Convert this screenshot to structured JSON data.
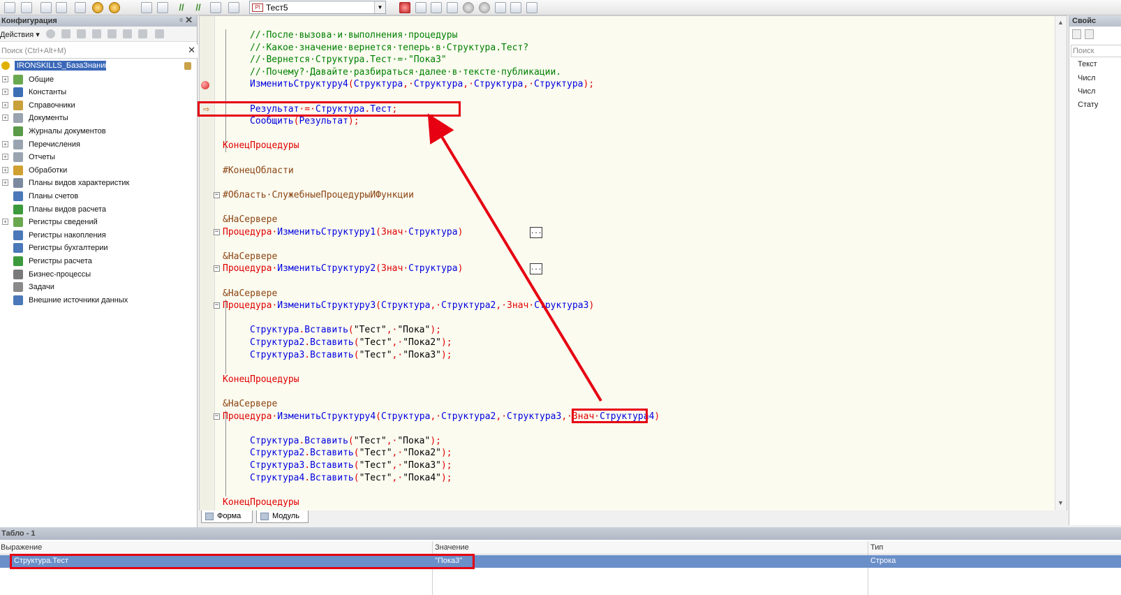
{
  "toolbar": {
    "combo_value": "Тест5",
    "combo_badge": "Pl"
  },
  "left_panel": {
    "title": "Конфигурация",
    "pin_glyph": "ᵠ",
    "close_glyph": "✕",
    "actions_label": "Действия ▾",
    "search_placeholder": "Поиск (Ctrl+Alt+M)",
    "search_clear": "✕",
    "root": "IRONSKILLS_БазаЗнаний",
    "items": [
      {
        "label": "Общие",
        "expandable": true,
        "icon_color": "#6aa84f"
      },
      {
        "label": "Константы",
        "expandable": true,
        "icon_color": "#3d6fb5"
      },
      {
        "label": "Справочники",
        "expandable": true,
        "icon_color": "#c9a13c"
      },
      {
        "label": "Документы",
        "expandable": true,
        "icon_color": "#9aa4b0"
      },
      {
        "label": "Журналы документов",
        "expandable": false,
        "icon_color": "#5a9a48"
      },
      {
        "label": "Перечисления",
        "expandable": true,
        "icon_color": "#9aa4b0"
      },
      {
        "label": "Отчеты",
        "expandable": true,
        "icon_color": "#9aa4b0"
      },
      {
        "label": "Обработки",
        "expandable": true,
        "icon_color": "#d0a030"
      },
      {
        "label": "Планы видов характеристик",
        "expandable": true,
        "icon_color": "#7c8aa0"
      },
      {
        "label": "Планы счетов",
        "expandable": false,
        "icon_color": "#4a78b8"
      },
      {
        "label": "Планы видов расчета",
        "expandable": false,
        "icon_color": "#3c9a3c"
      },
      {
        "label": "Регистры сведений",
        "expandable": true,
        "icon_color": "#6aa84f"
      },
      {
        "label": "Регистры накопления",
        "expandable": false,
        "icon_color": "#4a78b8"
      },
      {
        "label": "Регистры бухгалтерии",
        "expandable": false,
        "icon_color": "#4a78b8"
      },
      {
        "label": "Регистры расчета",
        "expandable": false,
        "icon_color": "#3c9a3c"
      },
      {
        "label": "Бизнес-процессы",
        "expandable": false,
        "icon_color": "#7a7a7a"
      },
      {
        "label": "Задачи",
        "expandable": false,
        "icon_color": "#8a8a8a"
      },
      {
        "label": "Внешние источники данных",
        "expandable": false,
        "icon_color": "#4a78b8"
      }
    ]
  },
  "editor": {
    "fold_minus": "⊟",
    "dots_label": "...",
    "lines": [
      [
        {
          "t": "//·После·вызова·и·выполнения·процедуры",
          "c": "cm"
        }
      ],
      [
        {
          "t": "//·Какое·значение·вернется·теперь·в·Структура.Тест?",
          "c": "cm"
        }
      ],
      [
        {
          "t": "//·Вернется·Структура.Тест·=·\"Пока3\"",
          "c": "cm"
        }
      ],
      [
        {
          "t": "//·Почему?·Давайте·разбираться·далее·в·тексте·публикации.",
          "c": "cm"
        }
      ],
      [
        {
          "t": "ИзменитьСтруктуру4",
          "c": "id"
        },
        {
          "t": "(",
          "c": "kw"
        },
        {
          "t": "Структура",
          "c": "id"
        },
        {
          "t": ",·",
          "c": "kw"
        },
        {
          "t": "Структура",
          "c": "id"
        },
        {
          "t": ",·",
          "c": "kw"
        },
        {
          "t": "Структура",
          "c": "id"
        },
        {
          "t": ",·",
          "c": "kw"
        },
        {
          "t": "Структура",
          "c": "id"
        },
        {
          "t": ");",
          "c": "kw"
        }
      ],
      [],
      [
        {
          "t": "Результат",
          "c": "id"
        },
        {
          "t": "·=·",
          "c": "kw"
        },
        {
          "t": "Структура",
          "c": "id"
        },
        {
          "t": ".",
          "c": "kw"
        },
        {
          "t": "Тест",
          "c": "id"
        },
        {
          "t": ";",
          "c": "kw"
        }
      ],
      [
        {
          "t": "Сообщить",
          "c": "id"
        },
        {
          "t": "(",
          "c": "kw"
        },
        {
          "t": "Результат",
          "c": "id"
        },
        {
          "t": ");",
          "c": "kw"
        }
      ],
      [],
      [
        {
          "t": "КонецПроцедуры",
          "c": "kw"
        }
      ],
      [],
      [
        {
          "t": "#КонецОбласти",
          "c": "pr"
        }
      ],
      [],
      [
        {
          "t": "#Область·СлужебныеПроцедурыИФункции",
          "c": "pr"
        }
      ],
      [],
      [
        {
          "t": "&НаСервере",
          "c": "pr"
        }
      ],
      [
        {
          "t": "Процедура",
          "c": "kw"
        },
        {
          "t": "·",
          "c": "kw"
        },
        {
          "t": "ИзменитьСтруктуру1",
          "c": "id"
        },
        {
          "t": "(",
          "c": "kw"
        },
        {
          "t": "Знач",
          "c": "kw"
        },
        {
          "t": "·",
          "c": "kw"
        },
        {
          "t": "Структура",
          "c": "id"
        },
        {
          "t": ")",
          "c": "kw"
        }
      ],
      [],
      [
        {
          "t": "&НаСервере",
          "c": "pr"
        }
      ],
      [
        {
          "t": "Процедура",
          "c": "kw"
        },
        {
          "t": "·",
          "c": "kw"
        },
        {
          "t": "ИзменитьСтруктуру2",
          "c": "id"
        },
        {
          "t": "(",
          "c": "kw"
        },
        {
          "t": "Знач",
          "c": "kw"
        },
        {
          "t": "·",
          "c": "kw"
        },
        {
          "t": "Структура",
          "c": "id"
        },
        {
          "t": ")",
          "c": "kw"
        }
      ],
      [],
      [
        {
          "t": "&НаСервере",
          "c": "pr"
        }
      ],
      [
        {
          "t": "Процедура",
          "c": "kw"
        },
        {
          "t": "·",
          "c": "kw"
        },
        {
          "t": "ИзменитьСтруктуру3",
          "c": "id"
        },
        {
          "t": "(",
          "c": "kw"
        },
        {
          "t": "Структура",
          "c": "id"
        },
        {
          "t": ",·",
          "c": "kw"
        },
        {
          "t": "Структура2",
          "c": "id"
        },
        {
          "t": ",·",
          "c": "kw"
        },
        {
          "t": "Знач",
          "c": "kw"
        },
        {
          "t": "·",
          "c": "kw"
        },
        {
          "t": "Структура3",
          "c": "id"
        },
        {
          "t": ")",
          "c": "kw"
        }
      ],
      [],
      [
        {
          "t": "Структура",
          "c": "id"
        },
        {
          "t": ".",
          "c": "kw"
        },
        {
          "t": "Вставить",
          "c": "id"
        },
        {
          "t": "(",
          "c": "kw"
        },
        {
          "t": "\"Тест\"",
          "c": "st"
        },
        {
          "t": ",·",
          "c": "kw"
        },
        {
          "t": "\"Пока\"",
          "c": "st"
        },
        {
          "t": ");",
          "c": "kw"
        }
      ],
      [
        {
          "t": "Структура2",
          "c": "id"
        },
        {
          "t": ".",
          "c": "kw"
        },
        {
          "t": "Вставить",
          "c": "id"
        },
        {
          "t": "(",
          "c": "kw"
        },
        {
          "t": "\"Тест\"",
          "c": "st"
        },
        {
          "t": ",·",
          "c": "kw"
        },
        {
          "t": "\"Пока2\"",
          "c": "st"
        },
        {
          "t": ");",
          "c": "kw"
        }
      ],
      [
        {
          "t": "Структура3",
          "c": "id"
        },
        {
          "t": ".",
          "c": "kw"
        },
        {
          "t": "Вставить",
          "c": "id"
        },
        {
          "t": "(",
          "c": "kw"
        },
        {
          "t": "\"Тест\"",
          "c": "st"
        },
        {
          "t": ",·",
          "c": "kw"
        },
        {
          "t": "\"Пока3\"",
          "c": "st"
        },
        {
          "t": ");",
          "c": "kw"
        }
      ],
      [],
      [
        {
          "t": "КонецПроцедуры",
          "c": "kw"
        }
      ],
      [],
      [
        {
          "t": "&НаСервере",
          "c": "pr"
        }
      ],
      [
        {
          "t": "Процедура",
          "c": "kw"
        },
        {
          "t": "·",
          "c": "kw"
        },
        {
          "t": "ИзменитьСтруктуру4",
          "c": "id"
        },
        {
          "t": "(",
          "c": "kw"
        },
        {
          "t": "Структура",
          "c": "id"
        },
        {
          "t": ",·",
          "c": "kw"
        },
        {
          "t": "Структура2",
          "c": "id"
        },
        {
          "t": ",·",
          "c": "kw"
        },
        {
          "t": "Структура3",
          "c": "id"
        },
        {
          "t": ",·",
          "c": "kw"
        },
        {
          "t": "Знач",
          "c": "kw"
        },
        {
          "t": "·",
          "c": "kw"
        },
        {
          "t": "Структура4",
          "c": "id"
        },
        {
          "t": ")",
          "c": "kw"
        }
      ],
      [],
      [
        {
          "t": "Структура",
          "c": "id"
        },
        {
          "t": ".",
          "c": "kw"
        },
        {
          "t": "Вставить",
          "c": "id"
        },
        {
          "t": "(",
          "c": "kw"
        },
        {
          "t": "\"Тест\"",
          "c": "st"
        },
        {
          "t": ",·",
          "c": "kw"
        },
        {
          "t": "\"Пока\"",
          "c": "st"
        },
        {
          "t": ");",
          "c": "kw"
        }
      ],
      [
        {
          "t": "Структура2",
          "c": "id"
        },
        {
          "t": ".",
          "c": "kw"
        },
        {
          "t": "Вставить",
          "c": "id"
        },
        {
          "t": "(",
          "c": "kw"
        },
        {
          "t": "\"Тест\"",
          "c": "st"
        },
        {
          "t": ",·",
          "c": "kw"
        },
        {
          "t": "\"Пока2\"",
          "c": "st"
        },
        {
          "t": ");",
          "c": "kw"
        }
      ],
      [
        {
          "t": "Структура3",
          "c": "id"
        },
        {
          "t": ".",
          "c": "kw"
        },
        {
          "t": "Вставить",
          "c": "id"
        },
        {
          "t": "(",
          "c": "kw"
        },
        {
          "t": "\"Тест\"",
          "c": "st"
        },
        {
          "t": ",·",
          "c": "kw"
        },
        {
          "t": "\"Пока3\"",
          "c": "st"
        },
        {
          "t": ");",
          "c": "kw"
        }
      ],
      [
        {
          "t": "Структура4",
          "c": "id"
        },
        {
          "t": ".",
          "c": "kw"
        },
        {
          "t": "Вставить",
          "c": "id"
        },
        {
          "t": "(",
          "c": "kw"
        },
        {
          "t": "\"Тест\"",
          "c": "st"
        },
        {
          "t": ",·",
          "c": "kw"
        },
        {
          "t": "\"Пока4\"",
          "c": "st"
        },
        {
          "t": ");",
          "c": "kw"
        }
      ],
      [],
      [
        {
          "t": "КонецПроцедуры",
          "c": "kw"
        }
      ]
    ]
  },
  "editor_tabs": [
    "Форма",
    "Модуль"
  ],
  "right_panel": {
    "title": "Свойс",
    "search_placeholder": "Поиск",
    "rows": [
      "Текст",
      "Числ",
      "Числ",
      "Стату"
    ]
  },
  "watch_panel": {
    "title": "Табло - 1",
    "columns": [
      "Выражение",
      "Значение",
      "Тип"
    ],
    "rows": [
      {
        "expression": "Структура.Тест",
        "value": "\"Пока3\"",
        "type": "Строка"
      }
    ]
  },
  "colors": {
    "highlight": "#e60012",
    "selected_row": "#6a8fc9",
    "keyword": "#e00000",
    "identifier": "#0000e0",
    "comment": "#008000",
    "preprocessor": "#8b4513"
  }
}
